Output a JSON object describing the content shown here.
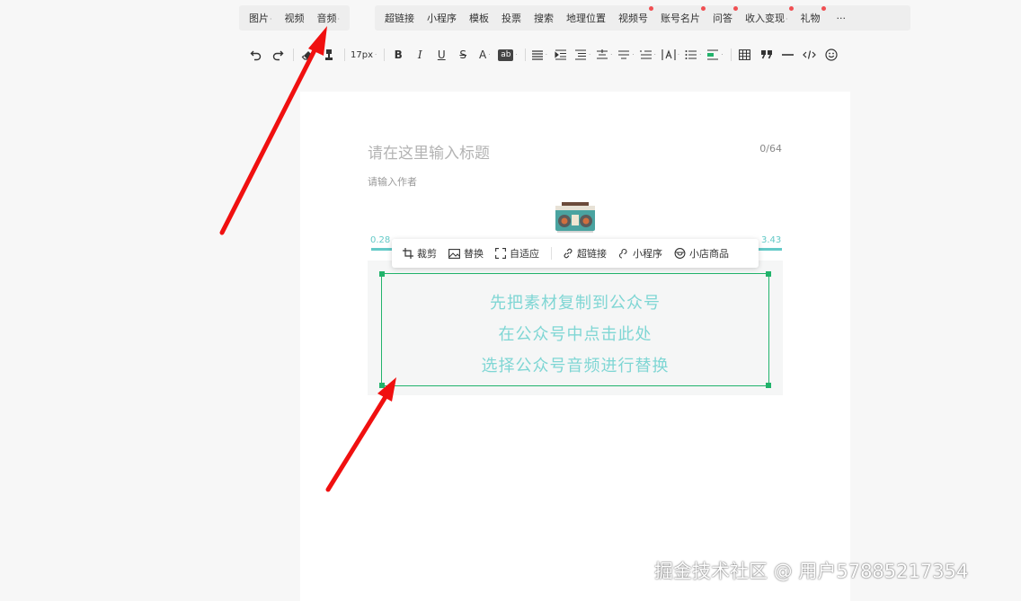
{
  "menubar": {
    "group1": [
      {
        "label": "图片",
        "caret": true
      },
      {
        "label": "视频",
        "caret": false
      },
      {
        "label": "音频",
        "caret": true
      }
    ],
    "group2": [
      {
        "label": "超链接",
        "caret": false,
        "dot": false
      },
      {
        "label": "小程序",
        "caret": false,
        "dot": false
      },
      {
        "label": "模板",
        "caret": false,
        "dot": false
      },
      {
        "label": "投票",
        "caret": false,
        "dot": false
      },
      {
        "label": "搜索",
        "caret": false,
        "dot": false
      },
      {
        "label": "地理位置",
        "caret": false,
        "dot": false
      },
      {
        "label": "视频号",
        "caret": false,
        "dot": true
      },
      {
        "label": "账号名片",
        "caret": false,
        "dot": true
      },
      {
        "label": "问答",
        "caret": false,
        "dot": true
      },
      {
        "label": "收入变现",
        "caret": true,
        "dot": true
      },
      {
        "label": "礼物",
        "caret": false,
        "dot": true
      }
    ],
    "more": "···",
    "caret_glyph": "·"
  },
  "toolbar": {
    "font_size": "17px",
    "bold": "B",
    "italic": "I",
    "underline": "U",
    "strike": "S",
    "font_color": "A",
    "bg_color": "ab",
    "caret": "·"
  },
  "editor": {
    "title_placeholder": "请在这里输入标题",
    "title_counter": "0/64",
    "author_placeholder": "请输入作者"
  },
  "audio": {
    "time_start": "0.28",
    "time_end": "3.43",
    "lines": [
      "先把素材复制到公众号",
      "在公众号中点击此处",
      "选择公众号音频进行替换"
    ]
  },
  "image_toolbar": {
    "crop": "裁剪",
    "replace": "替换",
    "fit": "自适应",
    "link": "超链接",
    "miniprogram": "小程序",
    "shop": "小店商品"
  },
  "watermark": "掘金技术社区 @ 用户57885217354",
  "colors": {
    "accent_green": "#21b36b",
    "audio_text": "#7fd6d4",
    "arrow_red": "#f01010",
    "badge_red": "#f04f52"
  }
}
